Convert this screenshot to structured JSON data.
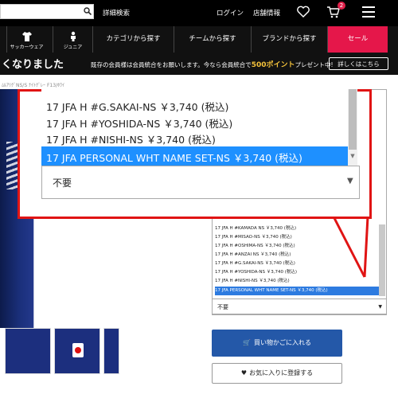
{
  "header": {
    "advanced_search": "詳細検索",
    "login": "ログイン",
    "store_info": "店舗情報",
    "cart_count": "2"
  },
  "nav": {
    "soccer_wear": "サッカーウェア",
    "junior": "ジュニア",
    "category": "カテゴリから探す",
    "team": "チームから探す",
    "brand": "ブランドから探す",
    "sale": "セール"
  },
  "banner": {
    "headline": "くなりました",
    "message_prefix": "既存の会員様は会員統合をお願いします。今なら会員統合で",
    "points": "500ポイント",
    "message_suffix": "プレゼント中!",
    "details_button": "詳しくはこちら"
  },
  "breadcrumb": "ﾑﾙｱﾘｸﾞNS/S ﾅｲﾄｸﾞﾚｰ F13/ﾎﾜｲ",
  "callout_dropdown": {
    "options": [
      "17 JFA H #G.SAKAI-NS ￥3,740 (税込)",
      "17 JFA H #YOSHIDA-NS ￥3,740 (税込)",
      "17 JFA H #NISHI-NS ￥3,740 (税込)",
      "17 JFA PERSONAL WHT NAME SET-NS ￥3,740 (税込)"
    ],
    "selected_value": "不要"
  },
  "small_dropdown": {
    "options": [
      "17 JFA H #KAMADA NS ￥3,740 (税込)",
      "17 JFA H #MISAO-NS ￥3,740 (税込)",
      "17 JFA H #OSHIMA-NS ￥3,740 (税込)",
      "17 JFA H #ANZAI NS ￥3,740 (税込)",
      "17 JFA H #G.SAKAI-NS ￥3,740 (税込)",
      "17 JFA H #YOSHIDA-NS ￥3,740 (税込)",
      "17 JFA H #NISHI-NS ￥3,740 (税込)",
      "17 JFA PERSONAL WHT NAME SET-NS ￥3,740 (税込)"
    ],
    "selected_value": "不要"
  },
  "buttons": {
    "add_to_cart": "買い物かごに入れる",
    "add_to_favorites": "お気に入りに登録する"
  },
  "colors": {
    "sale": "#e5174a",
    "highlight": "#1e90ff",
    "cart_button": "#2458a8",
    "callout_border": "#e01414"
  }
}
